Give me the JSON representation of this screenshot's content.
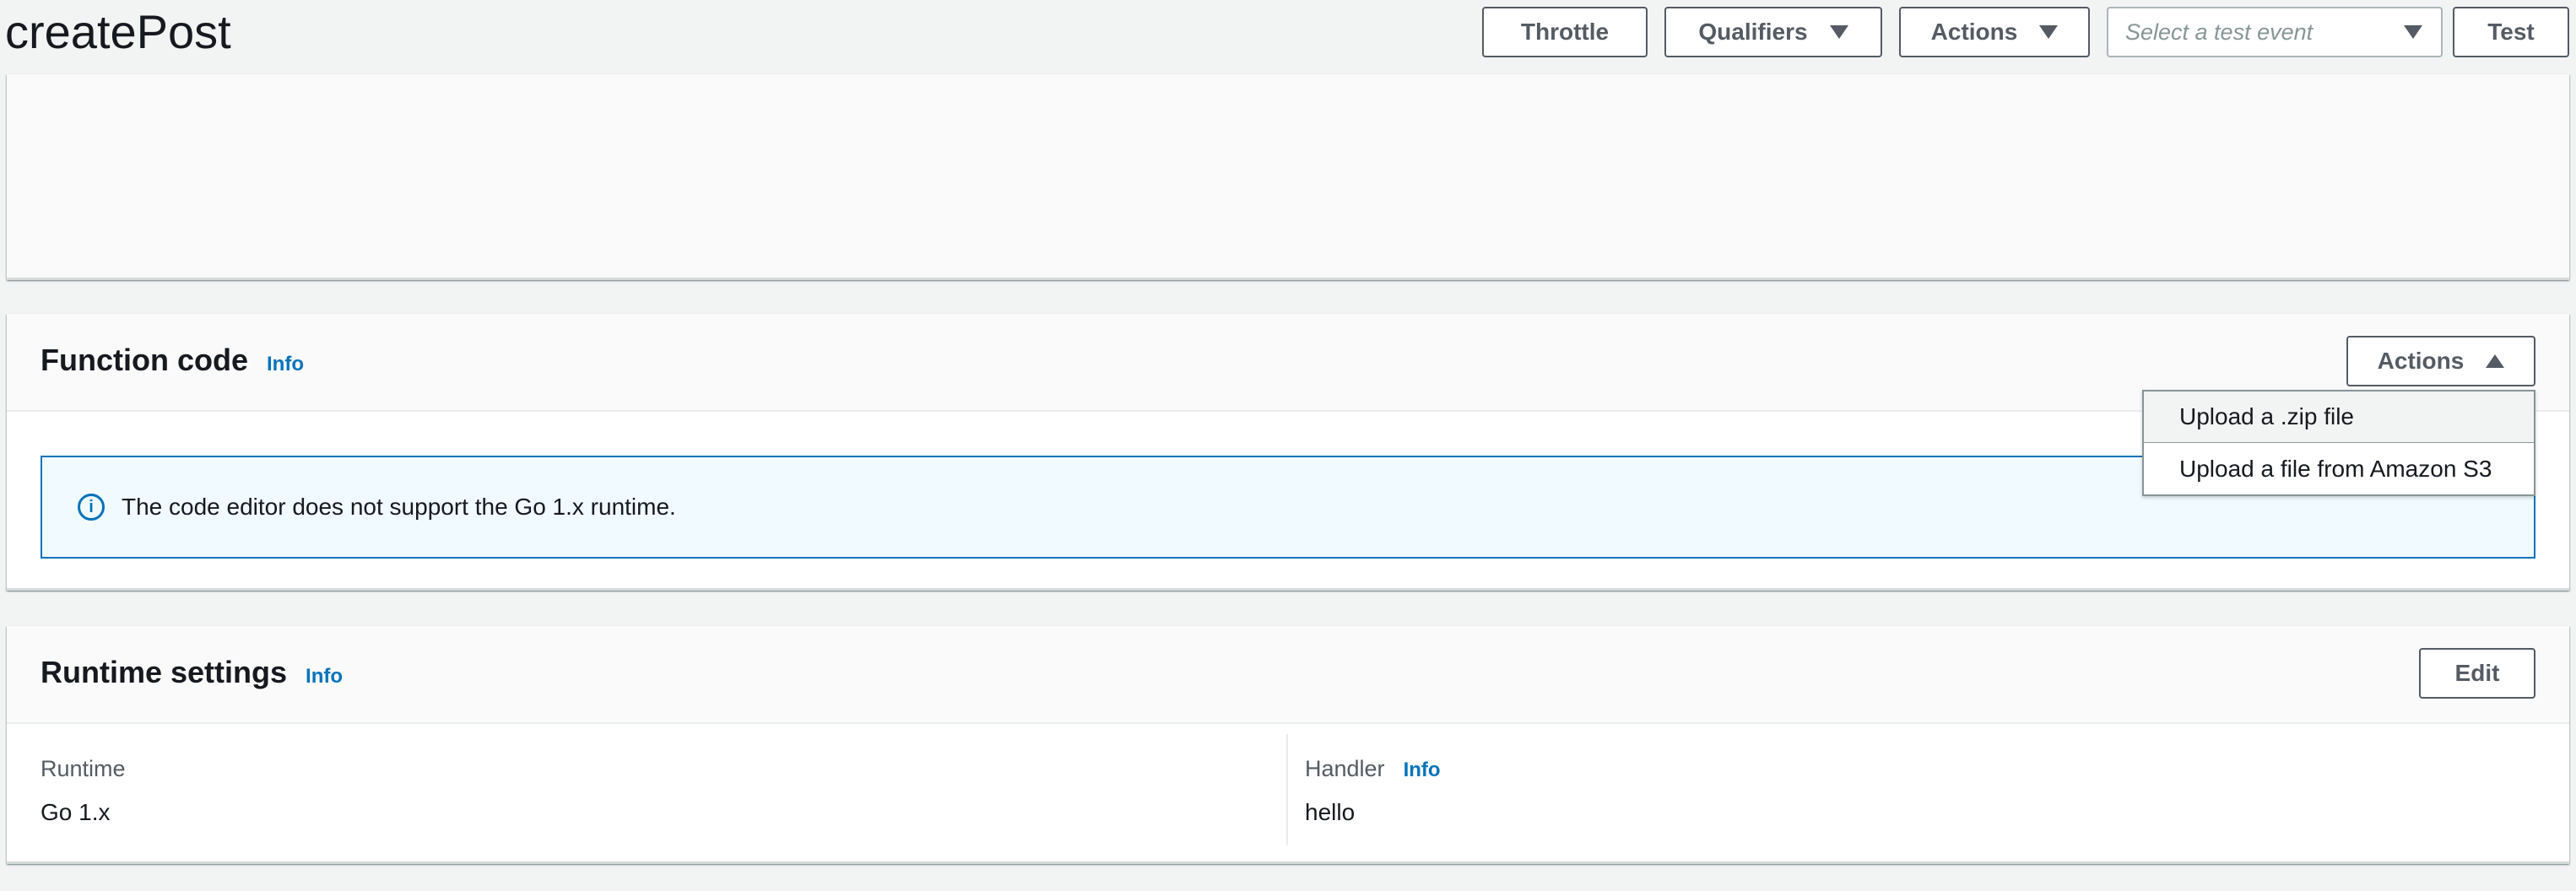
{
  "header": {
    "title": "createPost",
    "throttle_label": "Throttle",
    "qualifiers_label": "Qualifiers",
    "actions_label": "Actions",
    "test_event_placeholder": "Select a test event",
    "test_label": "Test"
  },
  "function_code": {
    "title": "Function code",
    "info_label": "Info",
    "actions_label": "Actions",
    "alert_text": "The code editor does not support the Go 1.x runtime.",
    "dropdown_items": [
      {
        "label": "Upload a .zip file",
        "highlighted": true
      },
      {
        "label": "Upload a file from Amazon S3",
        "highlighted": false
      }
    ]
  },
  "runtime_settings": {
    "title": "Runtime settings",
    "info_label": "Info",
    "edit_label": "Edit",
    "runtime_label": "Runtime",
    "runtime_value": "Go 1.x",
    "handler_label": "Handler",
    "handler_info_label": "Info",
    "handler_value": "hello"
  },
  "colors": {
    "accent_link": "#0073bb",
    "button_text": "#545b64",
    "page_background": "#f2f3f3",
    "alert_background": "#f1faff"
  },
  "icons": [
    "caret-down-icon",
    "caret-up-icon",
    "info-circle-icon"
  ]
}
